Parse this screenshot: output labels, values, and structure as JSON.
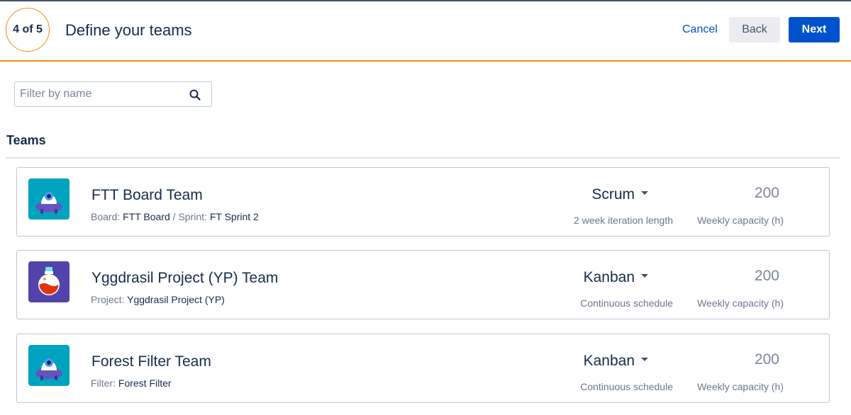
{
  "header": {
    "step": "4 of 5",
    "title": "Define your teams",
    "cancel_label": "Cancel",
    "back_label": "Back",
    "next_label": "Next"
  },
  "filter": {
    "placeholder": "Filter by name",
    "value": ""
  },
  "section": {
    "title": "Teams"
  },
  "teams": [
    {
      "name": "FTT Board Team",
      "avatar_icon": "ufo-icon",
      "source_label": "Board:",
      "source_value": "FTT Board",
      "separator": " / ",
      "sprint_label": "Sprint:",
      "sprint_value": "FT Sprint 2",
      "method": "Scrum",
      "schedule": "2 week iteration length",
      "capacity": "200",
      "capacity_label": "Weekly capacity (h)"
    },
    {
      "name": "Yggdrasil Project (YP) Team",
      "avatar_icon": "potion-flask-icon",
      "source_label": "Project:",
      "source_value": "Yggdrasil Project (YP)",
      "method": "Kanban",
      "schedule": "Continuous schedule",
      "capacity": "200",
      "capacity_label": "Weekly capacity (h)"
    },
    {
      "name": "Forest Filter Team",
      "avatar_icon": "ufo-icon",
      "source_label": "Filter:",
      "source_value": "Forest Filter",
      "method": "Kanban",
      "schedule": "Continuous schedule",
      "capacity": "200",
      "capacity_label": "Weekly capacity (h)"
    }
  ],
  "colors": {
    "accent": "#0052cc",
    "progress_orange": "#f18d13",
    "text": "#172b4d",
    "subtle_text": "#6b778c",
    "ufo_background": "#00a3bf",
    "ufo_body": "#6554c0",
    "flask_background": "#5243aa",
    "flask_liquid": "#de350b"
  }
}
